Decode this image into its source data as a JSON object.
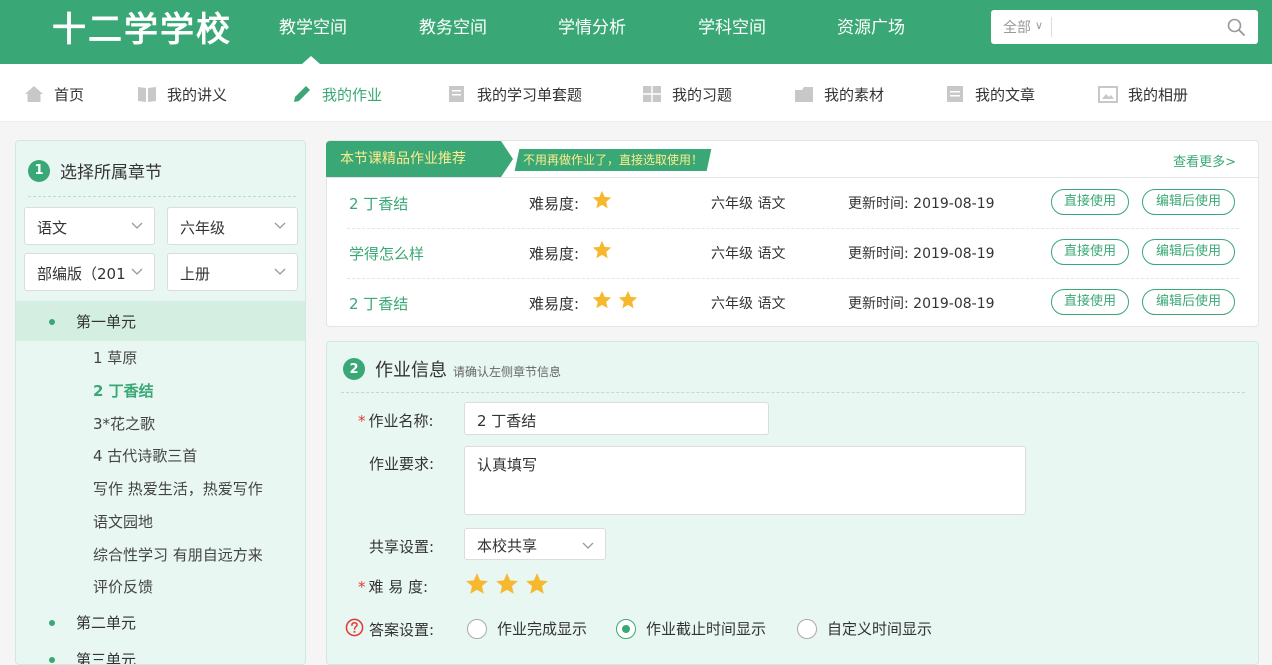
{
  "app": {
    "logo": "十二学学校",
    "nav": [
      "教学空间",
      "教务空间",
      "学情分析",
      "学科空间",
      "资源广场"
    ],
    "search": {
      "scope": "全部",
      "placeholder": ""
    }
  },
  "subnav": [
    {
      "label": "首页",
      "icon": "home-icon"
    },
    {
      "label": "我的讲义",
      "icon": "book-icon"
    },
    {
      "label": "我的作业",
      "icon": "pencil-icon",
      "active": true
    },
    {
      "label": "我的学习单套题",
      "icon": "worksheet-icon"
    },
    {
      "label": "我的习题",
      "icon": "grid-icon"
    },
    {
      "label": "我的素材",
      "icon": "folder-icon"
    },
    {
      "label": "我的文章",
      "icon": "document-icon"
    },
    {
      "label": "我的相册",
      "icon": "picture-icon"
    }
  ],
  "chapter": {
    "step": "1",
    "title": "选择所属章节",
    "subject": "语文",
    "grade": "六年级",
    "edition": "部编版（201",
    "volume": "上册",
    "units": [
      "第一单元",
      "第二单元",
      "第三单元"
    ],
    "lessons": [
      "1 草原",
      "2 丁香结",
      "3*花之歌",
      "4 古代诗歌三首",
      "写作 热爱生活，热爱写作",
      "语文园地",
      "综合性学习 有朋自远方来",
      "评价反馈"
    ]
  },
  "recommend": {
    "tag": "本节课精品作业推荐",
    "slogan": "不用再做作业了，直接选取使用！",
    "more": "查看更多>",
    "diff_label": "难易度:",
    "date_label": "更新时间:",
    "use_direct": "直接使用",
    "use_edit": "编辑后使用",
    "rows": [
      {
        "name": "2 丁香结",
        "stars": 1,
        "grade": "六年级 语文",
        "date": "2019-08-19"
      },
      {
        "name": "学得怎么样",
        "stars": 1,
        "grade": "六年级 语文",
        "date": "2019-08-19"
      },
      {
        "name": "2 丁香结",
        "stars": 2,
        "grade": "六年级 语文",
        "date": "2019-08-19"
      }
    ]
  },
  "info": {
    "step": "2",
    "title": "作业信息",
    "hint": "请确认左侧章节信息",
    "name_label": "作业名称:",
    "name_value": "2 丁香结",
    "req_label": "作业要求:",
    "req_value": "认真填写",
    "share_label": "共享设置:",
    "share_value": "本校共享",
    "diff_label": "难 易 度:",
    "diff_stars": 3,
    "answer_label": "答案设置:",
    "answer_options": [
      "作业完成显示",
      "作业截止时间显示",
      "自定义时间显示"
    ],
    "answer_selected": 1
  },
  "colors": {
    "accent": "#3aa876",
    "star": "#f5b82e",
    "slogan_text": "#ffec8b"
  }
}
